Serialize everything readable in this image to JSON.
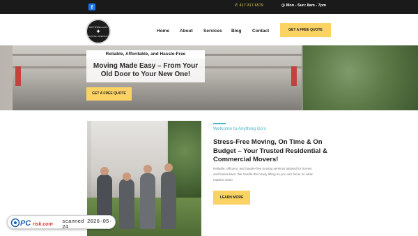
{
  "topbar": {
    "facebook_icon": "facebook-icon",
    "phone_icon": "phone-icon",
    "phone": "417-317-6579",
    "hours_icon": "clock-icon",
    "hours": "Mon - Sun: 8am - 7pm"
  },
  "header": {
    "logo_line1": "ANYTHING GO'S",
    "logo_line2": "MOVING SERVICES",
    "nav": [
      "Home",
      "About",
      "Services",
      "Blog",
      "Contact"
    ],
    "cta": "GET A FREE QUOTE"
  },
  "hero": {
    "tagline": "Reliable, Affordable, and Hassle-Free",
    "headline_line1": "Moving Made Easy – From Your",
    "headline_line2": "Old Door to Your New One!",
    "cta": "GET A FREE QUOTE"
  },
  "about": {
    "welcome": "Welcome to Anything Go's",
    "heading_line1": "Stress-Free Moving, On Time & On",
    "heading_line2": "Budget – Your Trusted Residential &",
    "heading_line3": "Commercial Movers!",
    "text_line1": "Reliable, efficient, and hassle-free moving services tailored for homes",
    "text_line2": "and businesses. We handle the heavy lifting so you can focus on what",
    "text_line3": "matters most!",
    "cta": "LEARN MORE"
  },
  "watermark": {
    "brand_left": "PC",
    "brand_right": "risk.com",
    "label": "scanned 2026-05-24"
  },
  "colors": {
    "accent": "#fbd264",
    "teal": "#4bb4c8",
    "topbar": "#1a1a1a"
  }
}
